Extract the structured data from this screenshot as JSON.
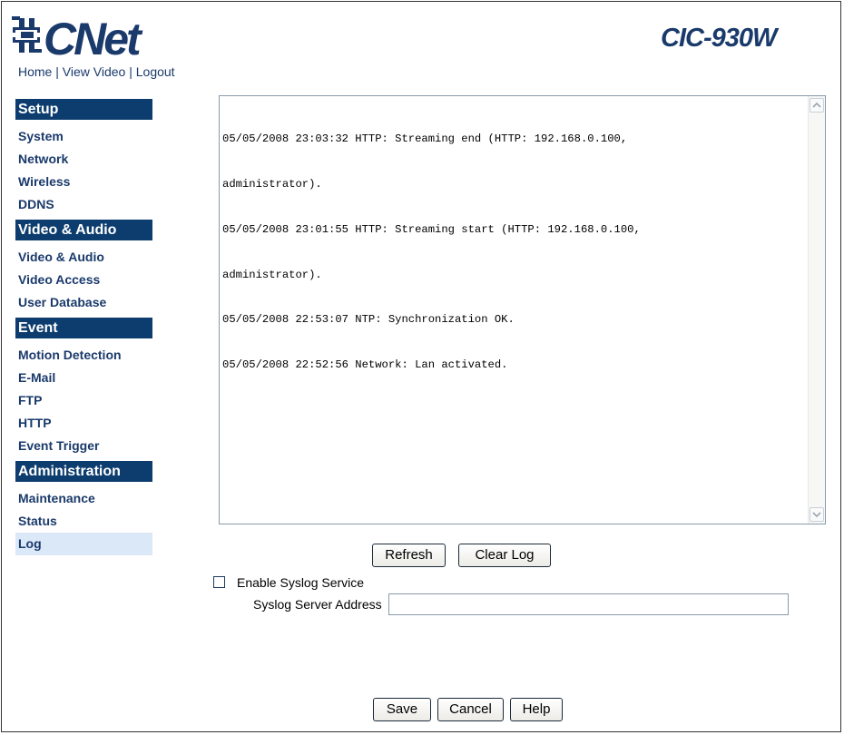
{
  "brand": {
    "logo_text": "CNet",
    "model": "CIC-930W",
    "color": "#1a3a6b"
  },
  "top_links": {
    "home": "Home",
    "view_video": "View Video",
    "logout": "Logout",
    "separator": " | "
  },
  "sidebar": {
    "header_color": "#0d3d6e",
    "sections": [
      {
        "title": "Setup",
        "items": [
          "System",
          "Network",
          "Wireless",
          "DDNS"
        ]
      },
      {
        "title": "Video & Audio",
        "items": [
          "Video & Audio",
          "Video Access",
          "User Database"
        ]
      },
      {
        "title": "Event",
        "items": [
          "Motion Detection",
          "E-Mail",
          "FTP",
          "HTTP",
          "Event Trigger"
        ]
      },
      {
        "title": "Administration",
        "items": [
          "Maintenance",
          "Status",
          "Log"
        ]
      }
    ],
    "active_item": "Log"
  },
  "log": {
    "lines": [
      "05/05/2008 23:03:32 HTTP: Streaming end (HTTP: 192.168.0.100,",
      "administrator).",
      "05/05/2008 23:01:55 HTTP: Streaming start (HTTP: 192.168.0.100,",
      "administrator).",
      "05/05/2008 22:53:07 NTP: Synchronization OK.",
      "05/05/2008 22:52:56 Network: Lan activated."
    ]
  },
  "log_buttons": {
    "refresh": "Refresh",
    "clear": "Clear Log"
  },
  "syslog": {
    "enable_label": "Enable Syslog Service",
    "enabled": false,
    "server_label": "Syslog Server Address",
    "server_value": ""
  },
  "footer": {
    "save": "Save",
    "cancel": "Cancel",
    "help": "Help"
  }
}
